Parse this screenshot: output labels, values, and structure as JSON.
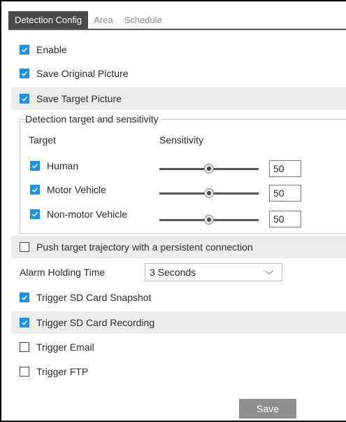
{
  "tabs": [
    {
      "label": "Detection Config",
      "active": true
    },
    {
      "label": "Area",
      "active": false
    },
    {
      "label": "Schedule",
      "active": false
    }
  ],
  "checkboxes": {
    "enable": {
      "label": "Enable",
      "checked": true
    },
    "save_original": {
      "label": "Save Original Picture",
      "checked": true
    },
    "save_target": {
      "label": "Save Target Picture",
      "checked": true
    },
    "push_trajectory": {
      "label": "Push target trajectory with a persistent connection",
      "checked": false
    },
    "trigger_sd_snapshot": {
      "label": "Trigger SD Card Snapshot",
      "checked": true
    },
    "trigger_sd_recording": {
      "label": "Trigger SD Card Recording",
      "checked": true
    },
    "trigger_email": {
      "label": "Trigger Email",
      "checked": false
    },
    "trigger_ftp": {
      "label": "Trigger FTP",
      "checked": false
    }
  },
  "detection_group": {
    "legend": "Detection target and sensitivity",
    "col_target": "Target",
    "col_sensitivity": "Sensitivity",
    "targets": [
      {
        "label": "Human",
        "checked": true,
        "sensitivity": "50",
        "slider_fraction": 0.5
      },
      {
        "label": "Motor Vehicle",
        "checked": true,
        "sensitivity": "50",
        "slider_fraction": 0.5
      },
      {
        "label": "Non-motor Vehicle",
        "checked": true,
        "sensitivity": "50",
        "slider_fraction": 0.5
      }
    ]
  },
  "alarm_holding": {
    "label": "Alarm Holding Time",
    "value": "3 Seconds"
  },
  "save_button": "Save",
  "colors": {
    "checkbox_accent": "#1e90e6",
    "tab_active": "#4a4a4a",
    "button": "#8e8e8e"
  },
  "icons": {
    "checkbox": "check-icon",
    "dropdown": "chevron-down-icon"
  }
}
